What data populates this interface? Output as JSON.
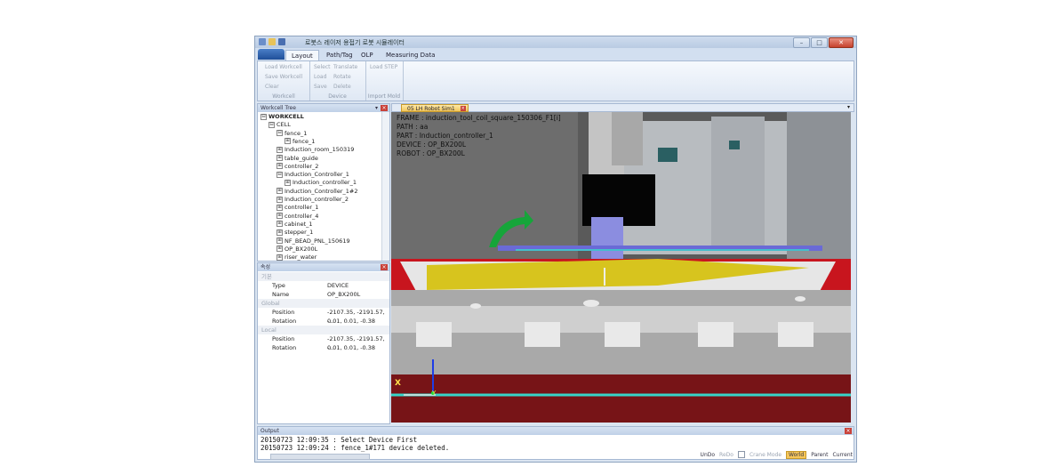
{
  "window": {
    "title": "로봇스 레이저 용접기 로봇 시뮬레이터",
    "buttons": {
      "minimize": "–",
      "maximize": "□",
      "close": "✕"
    }
  },
  "ribbon": {
    "tabs": [
      "Layout",
      "Path/Tag",
      "OLP",
      "Measuring Data"
    ],
    "groups": {
      "workcell": {
        "label": "Workcell",
        "items": [
          "Load Workcell",
          "Save Workcell",
          "Clear"
        ]
      },
      "device": {
        "label": "Device",
        "items": [
          "Select",
          "Translate",
          "Load",
          "Rotate",
          "Save",
          "Delete"
        ]
      },
      "import": {
        "label": "Import Mold",
        "items": [
          "Load STEP"
        ]
      }
    }
  },
  "workcell_tree": {
    "title": "Workcell Tree",
    "pin": "▾",
    "items": [
      {
        "label": "WORKCELL",
        "indent": 0,
        "expander": "⊟"
      },
      {
        "label": "CELL",
        "indent": 1,
        "expander": "⊟"
      },
      {
        "label": "fence_1",
        "indent": 2,
        "expander": "⊟"
      },
      {
        "label": "fence_1",
        "indent": 3,
        "expander": "⊞"
      },
      {
        "label": "Induction_room_150319",
        "indent": 2,
        "expander": "⊞"
      },
      {
        "label": "table_guide",
        "indent": 2,
        "expander": "⊞"
      },
      {
        "label": "controller_2",
        "indent": 2,
        "expander": "⊞"
      },
      {
        "label": "Induction_Controller_1",
        "indent": 2,
        "expander": "⊟"
      },
      {
        "label": "Induction_controller_1",
        "indent": 3,
        "expander": "⊞"
      },
      {
        "label": "Induction_Controller_1#2",
        "indent": 2,
        "expander": "⊞"
      },
      {
        "label": "Induction_controller_2",
        "indent": 2,
        "expander": "⊞"
      },
      {
        "label": "controller_1",
        "indent": 2,
        "expander": "⊞"
      },
      {
        "label": "controller_4",
        "indent": 2,
        "expander": "⊞"
      },
      {
        "label": "cabinet_1",
        "indent": 2,
        "expander": "⊞"
      },
      {
        "label": "stepper_1",
        "indent": 2,
        "expander": "⊞"
      },
      {
        "label": "NF_BEAD_PNL_150619",
        "indent": 2,
        "expander": "⊞"
      },
      {
        "label": "OP_BX200L",
        "indent": 2,
        "expander": "⊞"
      },
      {
        "label": "riser_water",
        "indent": 2,
        "expander": "⊞"
      }
    ]
  },
  "properties": {
    "title": "속성",
    "rows": [
      {
        "kind": "cat",
        "label": "기본"
      },
      {
        "kind": "kv",
        "key": "Type",
        "value": "DEVICE"
      },
      {
        "kind": "kv",
        "key": "Name",
        "value": "OP_BX200L"
      },
      {
        "kind": "cat",
        "label": "Global"
      },
      {
        "kind": "kv",
        "key": "Position",
        "value": "-2107.35, -2191.57, -..."
      },
      {
        "kind": "kv",
        "key": "Rotation",
        "value": "0.01, 0.01, -0.38"
      },
      {
        "kind": "cat",
        "label": "Local"
      },
      {
        "kind": "kv",
        "key": "Position",
        "value": "-2107.35, -2191.57, -..."
      },
      {
        "kind": "kv",
        "key": "Rotation",
        "value": "0.01, 0.01, -0.38"
      }
    ]
  },
  "viewport": {
    "tab_label": "05 LH Robot Sim1",
    "info": {
      "frame": "FRAME : induction_tool_coil_square_150306_F1[i]",
      "path": "PATH : aa",
      "part": "PART : Induction_controller_1",
      "device": "DEVICE : OP_BX200L",
      "robot": "ROBOT : OP_BX200L"
    },
    "axis_x": "X",
    "axis_y": "Y"
  },
  "output": {
    "title": "Output",
    "lines": [
      "20150723 12:09:35 : Select Device First",
      "20150723 12:09:24 : fence_1#171 device deleted."
    ]
  },
  "statusbar": {
    "undo": "UnDo",
    "redo": "ReDo",
    "crane": "Crane Mode",
    "world": "World",
    "parent": "Parent",
    "current": "Current"
  }
}
